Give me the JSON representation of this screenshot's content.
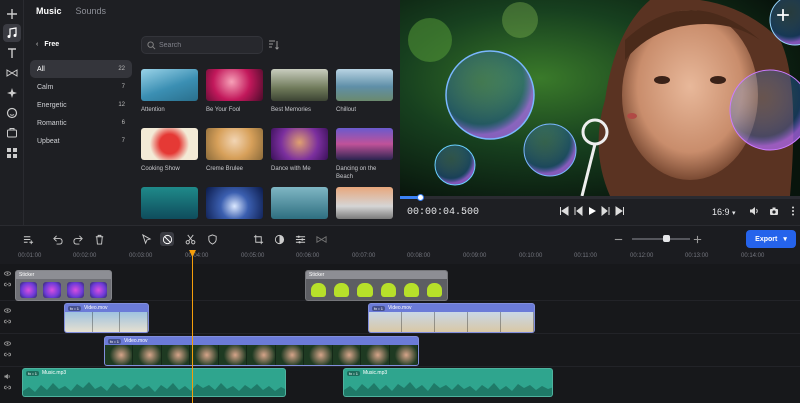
{
  "media": {
    "tabs": [
      "Music",
      "Sounds"
    ],
    "active_tab": "Music",
    "back_label": "Free",
    "search_placeholder": "Search",
    "categories": [
      {
        "label": "All",
        "count": "22"
      },
      {
        "label": "Calm",
        "count": "7"
      },
      {
        "label": "Energetic",
        "count": "12"
      },
      {
        "label": "Romantic",
        "count": "6"
      },
      {
        "label": "Upbeat",
        "count": "7"
      }
    ],
    "tracks": [
      {
        "title": "Attention"
      },
      {
        "title": "Be Your Fool"
      },
      {
        "title": "Best Memories"
      },
      {
        "title": "Chillout"
      },
      {
        "title": "Cooking Show"
      },
      {
        "title": "Creme Brulee"
      },
      {
        "title": "Dance with Me"
      },
      {
        "title": "Dancing on the Beach"
      },
      {
        "title": ""
      },
      {
        "title": ""
      },
      {
        "title": ""
      },
      {
        "title": ""
      }
    ]
  },
  "preview": {
    "timecode": "00:00:04.500",
    "aspect_ratio": "16:9",
    "progress": 0.05
  },
  "toolbar": {
    "export_label": "Export"
  },
  "timeline": {
    "ruler": [
      "00:01:00",
      "00:02:00",
      "00:03:00",
      "00:04:00",
      "00:05:00",
      "00:06:00",
      "00:07:00",
      "00:08:00",
      "00:09:00",
      "00:10:00",
      "00:11:00",
      "00:12:00",
      "00:13:00",
      "00:14:00"
    ],
    "clips": {
      "sticker1": "Sticker",
      "sticker2": "Sticker",
      "video1": "Video.mov",
      "video2": "Video.mov",
      "video3": "Video.mov",
      "music1": "Music.mp3",
      "music2": "Music.mp3",
      "fx": "fx • 1"
    }
  },
  "colors": {
    "accent": "#2563eb",
    "playhead": "#f59e0b",
    "video_clip": "#6b7bd8",
    "music_clip": "#2fa58e",
    "sticker_clip": "#8d8e94"
  }
}
